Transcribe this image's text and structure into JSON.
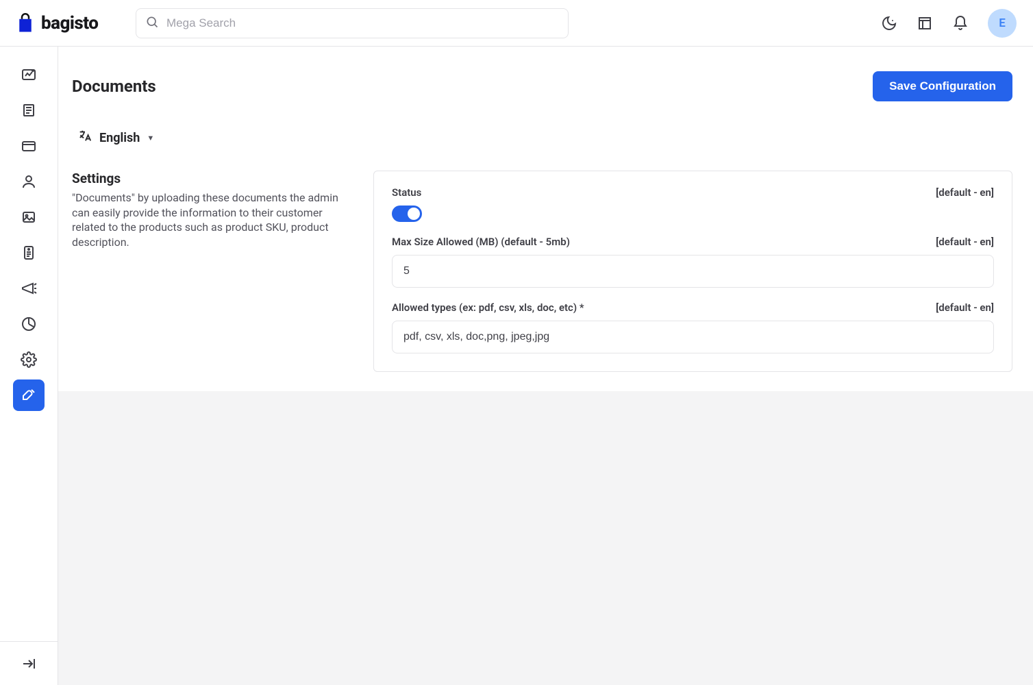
{
  "brand": "bagisto",
  "search": {
    "placeholder": "Mega Search"
  },
  "avatar": {
    "initial": "E"
  },
  "page": {
    "title": "Documents",
    "save_label": "Save Configuration"
  },
  "locale": {
    "language": "English"
  },
  "settings": {
    "heading": "Settings",
    "description": "\"Documents\" by uploading these documents the admin can easily provide the information to their customer related to the products such as product SKU, product description."
  },
  "scope_hint": "[default - en]",
  "fields": {
    "status": {
      "label": "Status",
      "enabled": true
    },
    "max_size": {
      "label": "Max Size Allowed (MB) (default - 5mb)",
      "value": "5"
    },
    "allowed_types": {
      "label": "Allowed types (ex: pdf, csv, xls, doc, etc) *",
      "value": "pdf, csv, xls, doc,png, jpeg,jpg"
    }
  },
  "sidebar": {
    "items": [
      {
        "name": "dashboard"
      },
      {
        "name": "catalog"
      },
      {
        "name": "sales"
      },
      {
        "name": "customers"
      },
      {
        "name": "cms"
      },
      {
        "name": "velocity"
      },
      {
        "name": "marketing"
      },
      {
        "name": "reports"
      },
      {
        "name": "settings"
      },
      {
        "name": "configure",
        "active": true
      }
    ]
  }
}
